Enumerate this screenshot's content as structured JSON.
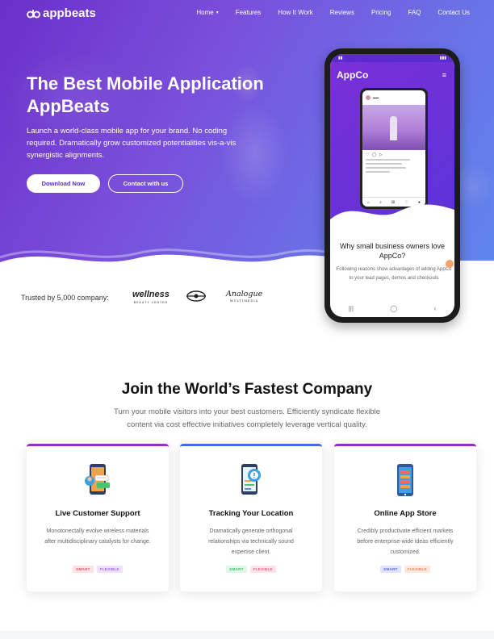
{
  "brand": {
    "name": "appbeats"
  },
  "nav": {
    "items": [
      {
        "label": "Home",
        "dropdown": true
      },
      {
        "label": "Features"
      },
      {
        "label": "How It Work"
      },
      {
        "label": "Reviews"
      },
      {
        "label": "Pricing"
      },
      {
        "label": "FAQ"
      },
      {
        "label": "Contact Us"
      }
    ]
  },
  "hero": {
    "title": "The Best Mobile Application AppBeats",
    "text": "Launch a world-class mobile app for your brand. No coding required. Dramatically grow customized potentialities vis-a-vis synergistic alignments.",
    "primary_label": "Download Now",
    "secondary_label": "Contact with us"
  },
  "phone": {
    "app_name": "AppCo",
    "why_title": "Why small business owners love AppCo?",
    "why_text": "Following reasons show advantages of adding AppCo to your lead pages, demos and checkouts"
  },
  "trusted": {
    "label": "Trusted by 5,000 company:",
    "brands": [
      {
        "name": "wellness",
        "tagline": "BEAUTY CENTER"
      },
      {
        "name": "Analogue",
        "tagline": "MULTIMEDIA"
      }
    ]
  },
  "section": {
    "title": "Join the World’s Fastest Company",
    "subtitle": "Turn your mobile visitors into your best customers. Efficiently syndicate flexible content via cost effective initiatives completely leverage vertical quality."
  },
  "cards": [
    {
      "title": "Live Customer Support",
      "text": "Monotonectally evolve wireless materials after multidisciplinary catalysts for change.",
      "tags": [
        "SMART",
        "FLEXIBLE"
      ],
      "icon": "customer-support-icon"
    },
    {
      "title": "Tracking Your Location",
      "text": "Dramatically generate orthogonal relationships via technically sound expertise client.",
      "tags": [
        "SMART",
        "FLEXIBLE"
      ],
      "icon": "location-tracking-icon"
    },
    {
      "title": "Online App Store",
      "text": "Credibly productivate efficient markets before enterprise-wide ideas efficiently customized.",
      "tags": [
        "SMART",
        "FLEXIBLE"
      ],
      "icon": "app-store-icon"
    }
  ],
  "colors": {
    "hero_start": "#6a2fc9",
    "hero_end": "#5f86ee",
    "accent_purple": "#9a2bc6",
    "accent_blue": "#3f6ee0"
  }
}
